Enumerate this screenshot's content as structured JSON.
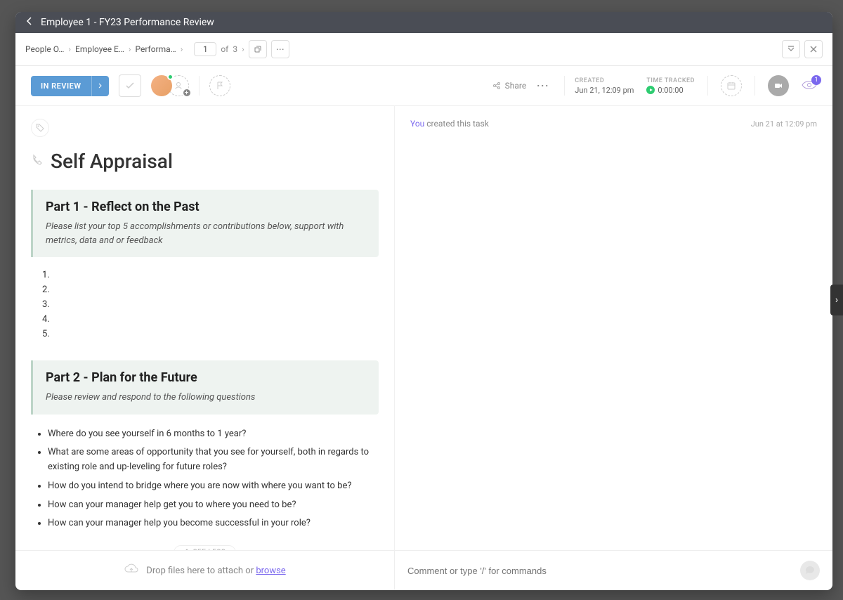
{
  "header": {
    "title": "Employee 1 - FY23 Performance Review"
  },
  "breadcrumbs": {
    "items": [
      "People O…",
      "Employee E…",
      "Performa…"
    ],
    "current_page": "1",
    "of_label": "of",
    "total_pages": "3"
  },
  "status": {
    "label": "IN REVIEW"
  },
  "share": {
    "label": "Share"
  },
  "meta": {
    "created_label": "CREATED",
    "created_value": "Jun 21, 12:09 pm",
    "time_tracked_label": "TIME TRACKED",
    "time_tracked_value": "0:00:00",
    "watcher_count": "1"
  },
  "task": {
    "title": "Self Appraisal",
    "part1": {
      "title": "Part 1 - Reflect on the Past",
      "subtitle": "Please list your top 5 accomplishments or contributions below, support with metrics, data and or feedback"
    },
    "part2": {
      "title": "Part 2 - Plan for the Future",
      "subtitle": "Please review and respond to the following questions",
      "questions": [
        "Where do you see yourself in 6 months to 1 year?",
        " What are some areas of opportunity that you see for yourself, both in regards to existing role and up-leveling for future roles?",
        " How do you intend to bridge where you are now with where you want to be?",
        " How can your manager help get you to where you need to be?",
        " How can your manager help you become successful in your role?"
      ]
    },
    "see_less": "SEE LESS"
  },
  "activity": {
    "you": "You",
    "action": " created this task",
    "timestamp": "Jun 21 at 12:09 pm"
  },
  "footer": {
    "drop_text": "Drop files here to attach or ",
    "browse": "browse",
    "comment_placeholder": "Comment or type '/' for commands"
  }
}
